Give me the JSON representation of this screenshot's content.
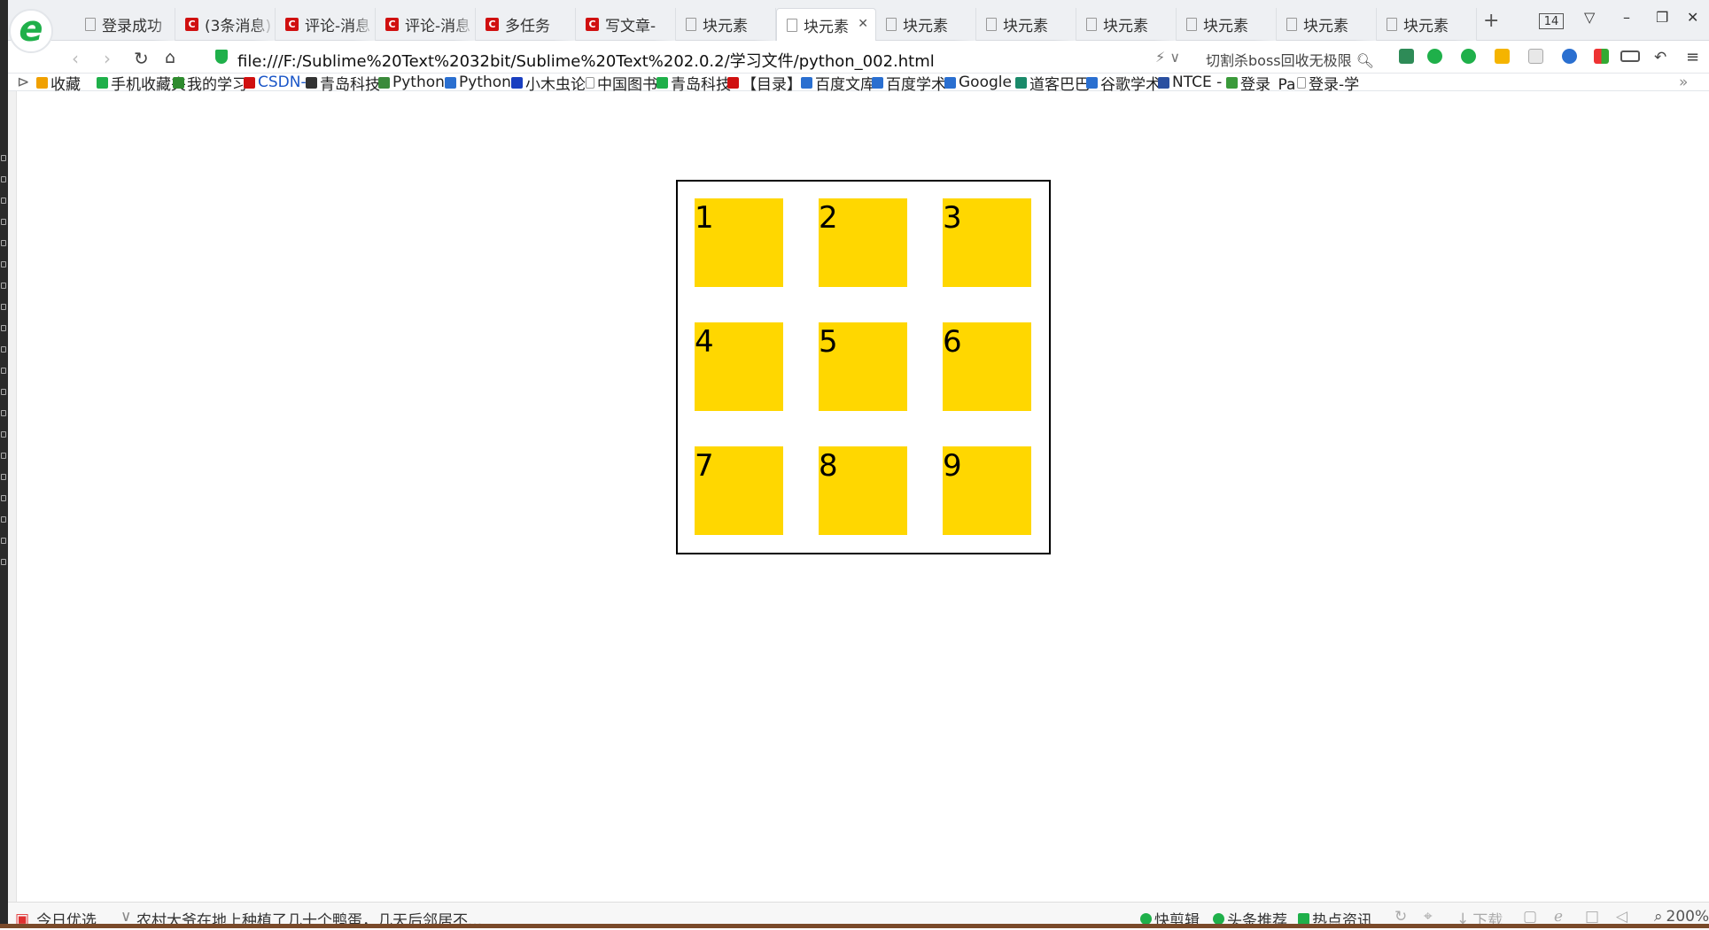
{
  "tabs": [
    {
      "title": "登录成功",
      "icon": "page-icon"
    },
    {
      "title": "(3条消息)",
      "icon": "csdn-icon"
    },
    {
      "title": "评论-消息",
      "icon": "csdn-icon"
    },
    {
      "title": "评论-消息",
      "icon": "csdn-icon"
    },
    {
      "title": "多任务",
      "icon": "csdn-icon"
    },
    {
      "title": "写文章-",
      "icon": "csdn-icon"
    },
    {
      "title": "块元素",
      "icon": "page-icon"
    },
    {
      "title": "块元素",
      "icon": "page-icon",
      "active": true
    },
    {
      "title": "块元素",
      "icon": "page-icon"
    },
    {
      "title": "块元素",
      "icon": "page-icon"
    },
    {
      "title": "块元素",
      "icon": "page-icon"
    },
    {
      "title": "块元素",
      "icon": "page-icon"
    },
    {
      "title": "块元素",
      "icon": "page-icon"
    },
    {
      "title": "块元素",
      "icon": "page-icon"
    }
  ],
  "tab_count": "14",
  "address": {
    "url": "file:///F:/Sublime%20Text%2032bit/Sublime%20Text%202.0.2/学习文件/python_002.html",
    "search_hint": "切割杀boss回收无极限"
  },
  "bookmarks": [
    {
      "label": "收藏",
      "icon": "star-icon",
      "color": "#f0a000"
    },
    {
      "label": "手机收藏夹",
      "icon": "phone-icon",
      "color": "#1fb04a"
    },
    {
      "label": "我的学习",
      "icon": "book-icon",
      "color": "#2e8b2e"
    },
    {
      "label": "CSDN-",
      "icon": "csdn-icon",
      "color": "#d01010"
    },
    {
      "label": "青岛科技",
      "icon": "d-icon",
      "color": "#333333"
    },
    {
      "label": "Python",
      "icon": "python-icon",
      "color": "#3a8a3a"
    },
    {
      "label": "Python",
      "icon": "rocket-icon",
      "color": "#2a6fd0"
    },
    {
      "label": "小木虫论",
      "icon": "grid-icon",
      "color": "#1a3fc0"
    },
    {
      "label": "中国图书",
      "icon": "page-icon",
      "color": "#999999"
    },
    {
      "label": "青岛科技",
      "icon": "leaf-icon",
      "color": "#1fb04a"
    },
    {
      "label": "【目录】",
      "icon": "csdn-icon",
      "color": "#d01010"
    },
    {
      "label": "百度文库",
      "icon": "paw-icon",
      "color": "#2a6fd0"
    },
    {
      "label": "百度学术",
      "icon": "paw-icon",
      "color": "#2a6fd0"
    },
    {
      "label": "Google",
      "icon": "translate-icon",
      "color": "#2a6fd0"
    },
    {
      "label": "道客巴巴",
      "icon": "doc-icon",
      "color": "#1a8a6a"
    },
    {
      "label": "谷歌学术",
      "icon": "scholar-icon",
      "color": "#2a6fd0"
    },
    {
      "label": "NTCE -",
      "icon": "globe-icon",
      "color": "#2a4fa0"
    },
    {
      "label": "登录_Pa",
      "icon": "pp-icon",
      "color": "#3a9a3a"
    },
    {
      "label": "登录-学",
      "icon": "page-icon",
      "color": "#999999"
    }
  ],
  "boxes": [
    "1",
    "2",
    "3",
    "4",
    "5",
    "6",
    "7",
    "8",
    "9"
  ],
  "status": {
    "today": "今日优选",
    "headline": "农村大爷在地上种植了几十个鸭蛋，几天后邻居不...",
    "kuaijian": "快剪辑",
    "toutiao": "头条推荐",
    "redian": "热点资讯",
    "download": "下载",
    "zoom": "200%"
  },
  "colors": {
    "box": "#ffd700",
    "accent": "#1fb04a"
  }
}
